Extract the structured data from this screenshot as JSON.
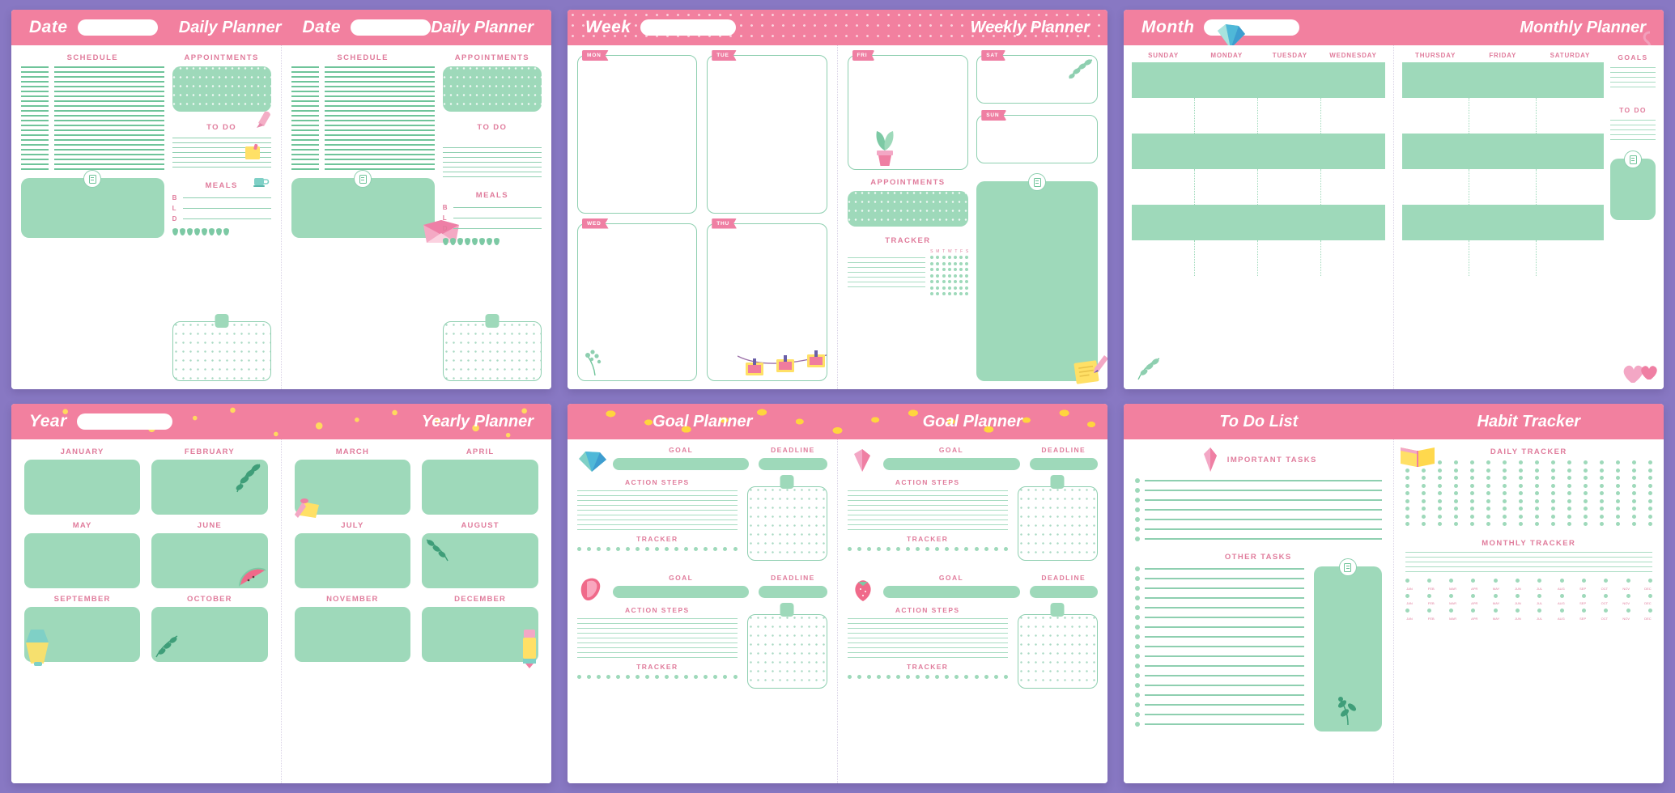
{
  "theme": {
    "background": "#8878c3",
    "pink": "#f2809f",
    "pink_text": "#e07c9c",
    "mint": "#9ed9ba",
    "mint_line": "#8ecfb0",
    "yellow": "#ffd95e",
    "paper": "#ffffff"
  },
  "daily": {
    "title": "Daily Planner",
    "date_label": "Date",
    "sections": {
      "schedule": "SCHEDULE",
      "appointments": "APPOINTMENTS",
      "todo": "TO DO",
      "meals": "MEALS"
    },
    "meal_keys": [
      "B",
      "L",
      "D"
    ],
    "schedule_line_count": 22,
    "todo_line_count": 7,
    "water_drop_count": 8,
    "icons": [
      "coffee-cup-icon",
      "note-doc-icon",
      "envelope-icon",
      "sticky-note-icon",
      "paint-brush-icon"
    ]
  },
  "weekly": {
    "title": "Weekly Planner",
    "week_label": "Week",
    "days": [
      "MON",
      "TUE",
      "WED",
      "THU",
      "FRI",
      "SAT",
      "SUN"
    ],
    "sections": {
      "appointments": "APPOINTMENTS",
      "tracker": "TRACKER"
    },
    "tracker_legend": [
      "S",
      "M",
      "T",
      "W",
      "T",
      "F",
      "S"
    ],
    "tracker_rows": 7,
    "tracker_cols": 7,
    "icons": [
      "leaf-branch-icon",
      "potted-plant-icon",
      "dandelion-icon",
      "photo-garland-icon",
      "note-doc-icon",
      "pencil-notepad-icon"
    ]
  },
  "monthly": {
    "title": "Monthly Planner",
    "month_label": "Month",
    "days_left": [
      "SUNDAY",
      "MONDAY",
      "TUESDAY",
      "WEDNESDAY"
    ],
    "days_right": [
      "THURSDAY",
      "FRIDAY",
      "SATURDAY"
    ],
    "sections": {
      "goals": "GOALS",
      "todo": "TO DO"
    },
    "row_count": 6,
    "icons": [
      "crystal-gem-icon",
      "leaf-branch-icon",
      "hearts-icon",
      "note-doc-icon",
      "ribbon-icon"
    ]
  },
  "yearly": {
    "title": "Yearly Planner",
    "year_label": "Year",
    "months_left": [
      "JANUARY",
      "FEBRUARY",
      "MAY",
      "JUNE",
      "SEPTEMBER",
      "OCTOBER"
    ],
    "months_right": [
      "MARCH",
      "APRIL",
      "JULY",
      "AUGUST",
      "NOVEMBER",
      "DECEMBER"
    ],
    "icons": [
      "leaf-branch-icon",
      "cake-slice-icon",
      "watermelon-icon",
      "desk-lamp-icon",
      "paint-tube-icon"
    ]
  },
  "goal": {
    "title_left": "Goal Planner",
    "title_right": "Goal Planner",
    "labels": {
      "goal": "GOAL",
      "deadline": "DEADLINE",
      "action_steps": "ACTION STEPS",
      "tracker": "TRACKER"
    },
    "blocks": 4,
    "action_line_count": 9,
    "tracker_dot_count": 17,
    "icons": [
      "diamond-gem-icon",
      "ruby-gem-icon",
      "pink-crystal-icon",
      "strawberry-icon"
    ]
  },
  "todolist": {
    "title": "To Do List",
    "sections": {
      "important": "IMPORTANT TASKS",
      "other": "OTHER TASKS"
    },
    "important_line_count": 7,
    "other_line_count": 17,
    "icons": [
      "pink-crystal-icon",
      "note-doc-icon",
      "plant-sprig-icon"
    ]
  },
  "habit": {
    "title": "Habit Tracker",
    "sections": {
      "daily": "DAILY TRACKER",
      "monthly": "MONTHLY TRACKER"
    },
    "daily_rows": 9,
    "daily_cols": 16,
    "monthly_months": [
      "JAN",
      "FEB",
      "MAR",
      "APR",
      "MAY",
      "JUN",
      "JUL",
      "AUG",
      "SEP",
      "OCT",
      "NOV",
      "DEC"
    ],
    "monthly_rows": 3,
    "icons": [
      "open-book-icon"
    ]
  }
}
